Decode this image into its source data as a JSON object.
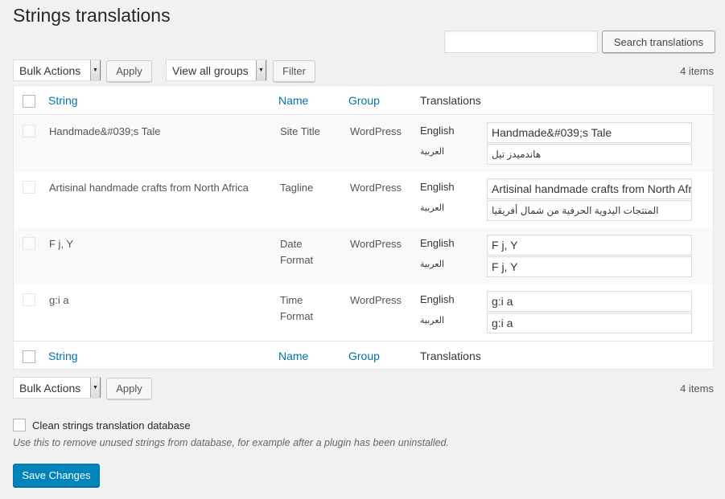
{
  "page": {
    "title": "Strings translations"
  },
  "search": {
    "placeholder": "",
    "value": "",
    "button_label": "Search translations"
  },
  "top_nav": {
    "bulk_actions": "Bulk Actions",
    "apply_label": "Apply",
    "group_filter": "View all groups",
    "filter_label": "Filter",
    "item_count": "4 items"
  },
  "table": {
    "columns": {
      "string": "String",
      "name": "Name",
      "group": "Group",
      "translations": "Translations"
    },
    "rows": [
      {
        "string": "Handmade&#039;s Tale",
        "name": "Site Title",
        "group": "WordPress",
        "translations": [
          {
            "language": "English",
            "value": "Handmade&#039;s Tale"
          },
          {
            "language": "العربية",
            "value": "هاندميدز تيل"
          }
        ]
      },
      {
        "string": "Artisinal handmade crafts from North Africa",
        "name": "Tagline",
        "group": "WordPress",
        "translations": [
          {
            "language": "English",
            "value": "Artisinal handmade crafts from North Africa"
          },
          {
            "language": "العربية",
            "value": "المنتجات اليدوية الحرفية من شمال أفريقيا"
          }
        ]
      },
      {
        "string": "F j, Y",
        "name": "Date Format",
        "group": "WordPress",
        "translations": [
          {
            "language": "English",
            "value": "F j, Y"
          },
          {
            "language": "العربية",
            "value": "F j, Y"
          }
        ]
      },
      {
        "string": "g:i a",
        "name": "Time Format",
        "group": "WordPress",
        "translations": [
          {
            "language": "English",
            "value": "g:i a"
          },
          {
            "language": "العربية",
            "value": "g:i a"
          }
        ]
      }
    ]
  },
  "bottom_nav": {
    "bulk_actions": "Bulk Actions",
    "apply_label": "Apply",
    "item_count": "4 items"
  },
  "clean": {
    "label": "Clean strings translation database",
    "checked": false,
    "description": "Use this to remove unused strings from database, for example after a plugin has been uninstalled."
  },
  "save_label": "Save Changes",
  "colors": {
    "accent": "#0085ba",
    "link": "#0073aa",
    "background": "#f1f1f1"
  }
}
